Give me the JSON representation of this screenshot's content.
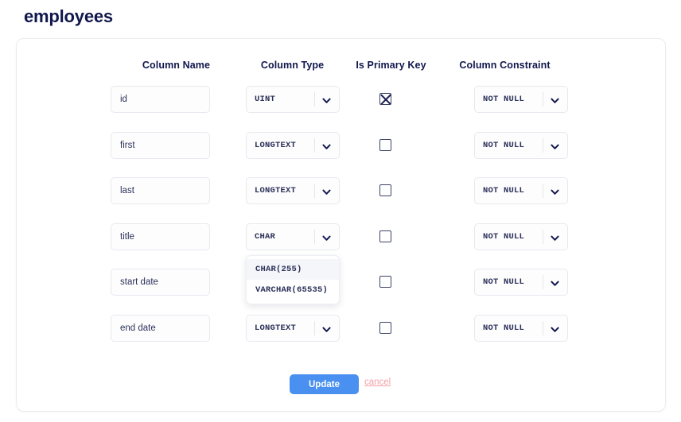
{
  "page": {
    "title": "employees"
  },
  "table": {
    "headers": [
      "Column Name",
      "Column Type",
      "Is Primary Key",
      "Column Constraint"
    ],
    "rows": [
      {
        "name": "id",
        "type": "UINT",
        "primary_key": true,
        "constraint": "NOT NULL"
      },
      {
        "name": "first",
        "type": "LONGTEXT",
        "primary_key": false,
        "constraint": "NOT NULL"
      },
      {
        "name": "last",
        "type": "LONGTEXT",
        "primary_key": false,
        "constraint": "NOT NULL"
      },
      {
        "name": "title",
        "type": "CHAR",
        "primary_key": false,
        "constraint": "NOT NULL"
      },
      {
        "name": "start date",
        "type": "",
        "primary_key": false,
        "constraint": "NOT NULL"
      },
      {
        "name": "end date",
        "type": "LONGTEXT",
        "primary_key": false,
        "constraint": "NOT NULL"
      }
    ]
  },
  "open_dropdown": {
    "row_index": 3,
    "options": [
      "CHAR(255)",
      "VARCHAR(65535)"
    ],
    "highlighted_index": 0
  },
  "footer": {
    "update_label": "Update",
    "cancel_label": "cancel"
  },
  "icons": {
    "chevron_down": "chevron-down-icon",
    "checkbox_cross": "cross-mark-icon"
  },
  "colors": {
    "title": "#11174d",
    "header_text": "#11174d",
    "primary_button": "#4a90f0",
    "cancel_link": "#f4a0a8",
    "field_border": "#e6e9ef",
    "card_border": "#e8ecef"
  }
}
